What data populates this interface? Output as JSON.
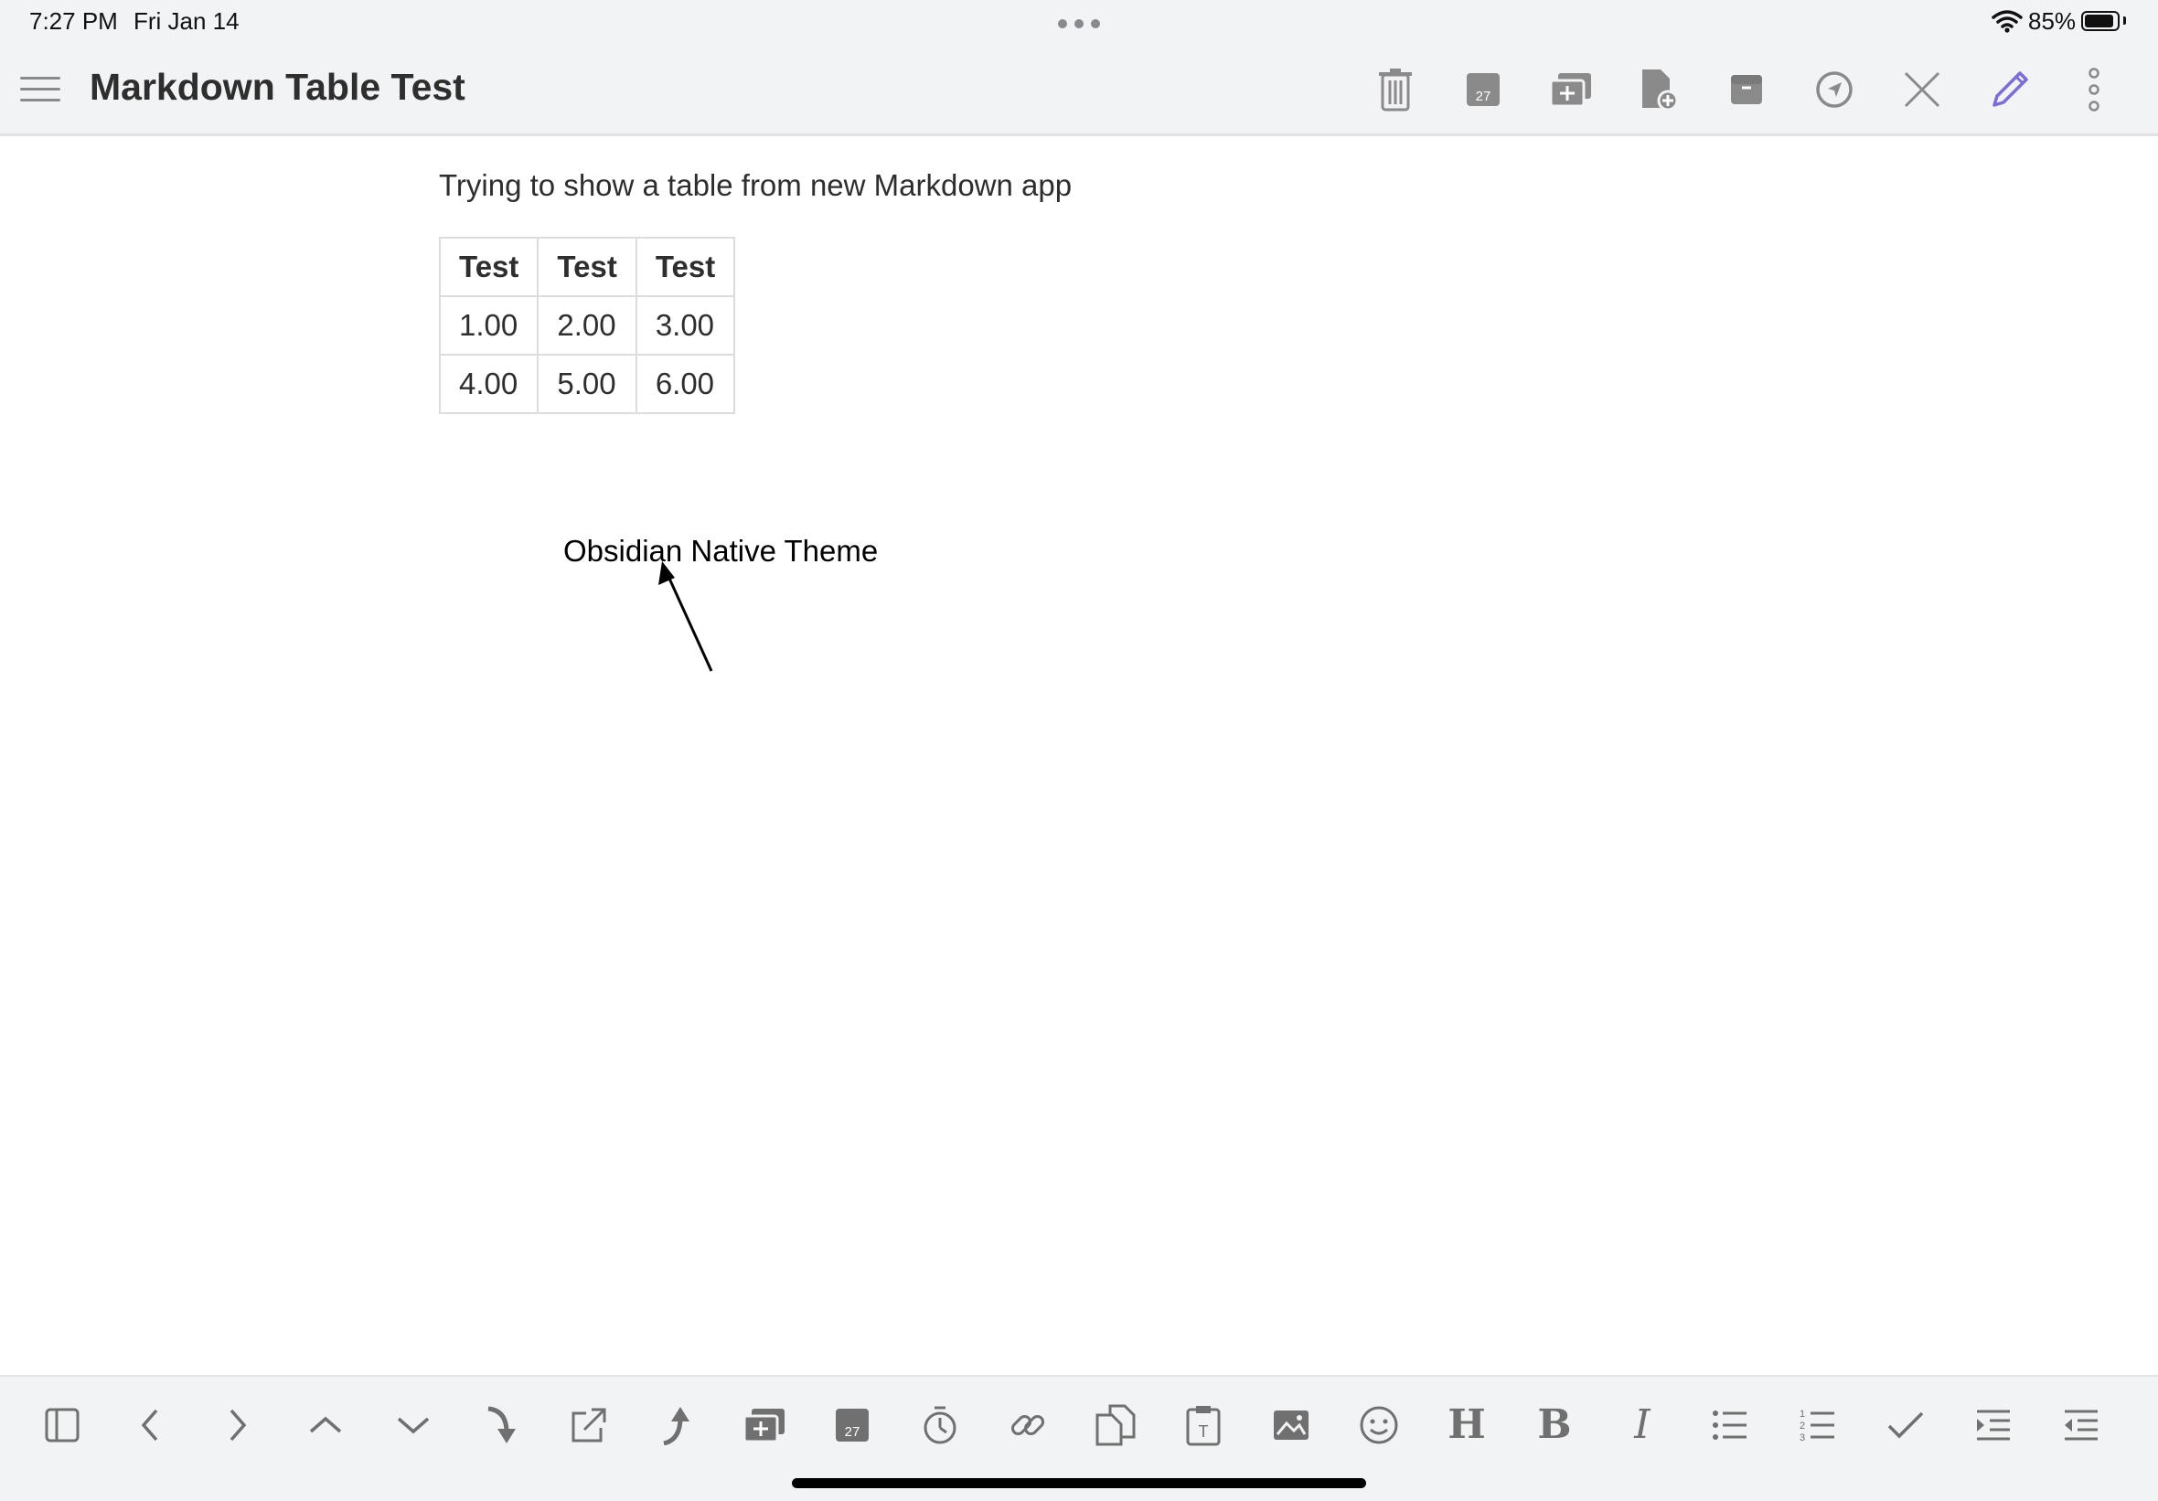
{
  "status_bar": {
    "time": "7:27 PM",
    "date": "Fri Jan 14",
    "battery_percent": "85%",
    "battery_level": 0.85
  },
  "header": {
    "title": "Markdown Table Test",
    "actions": [
      "trash-icon",
      "calendar-icon",
      "add-tab-icon",
      "new-file-icon",
      "archive-icon",
      "navigate-icon",
      "close-icon",
      "edit-pencil-icon",
      "more-vertical-icon"
    ],
    "accent_color": "#7b6cd9"
  },
  "document": {
    "paragraph": "Trying to show a table from new Markdown app",
    "table": {
      "headers": [
        "Test",
        "Test",
        "Test"
      ],
      "rows": [
        [
          "1.00",
          "2.00",
          "3.00"
        ],
        [
          "4.00",
          "5.00",
          "6.00"
        ]
      ]
    },
    "annotation": "Obsidian Native Theme"
  },
  "toolbar": {
    "icons": [
      "sidebar-toggle-icon",
      "chevron-left-icon",
      "chevron-right-icon",
      "chevron-up-icon",
      "chevron-down-icon",
      "curved-arrow-down-icon",
      "open-external-icon",
      "curved-arrow-up-icon",
      "add-tab-icon",
      "calendar-icon",
      "timer-icon",
      "link-icon",
      "copy-files-icon",
      "paste-text-icon",
      "image-icon",
      "emoji-icon",
      "heading-icon",
      "bold-icon",
      "italic-icon",
      "bullet-list-icon",
      "numbered-list-icon",
      "checkmark-icon",
      "indent-icon",
      "outdent-icon"
    ],
    "heading_glyph": "H",
    "bold_glyph": "B",
    "italic_glyph": "I",
    "calendar_day": "27"
  }
}
